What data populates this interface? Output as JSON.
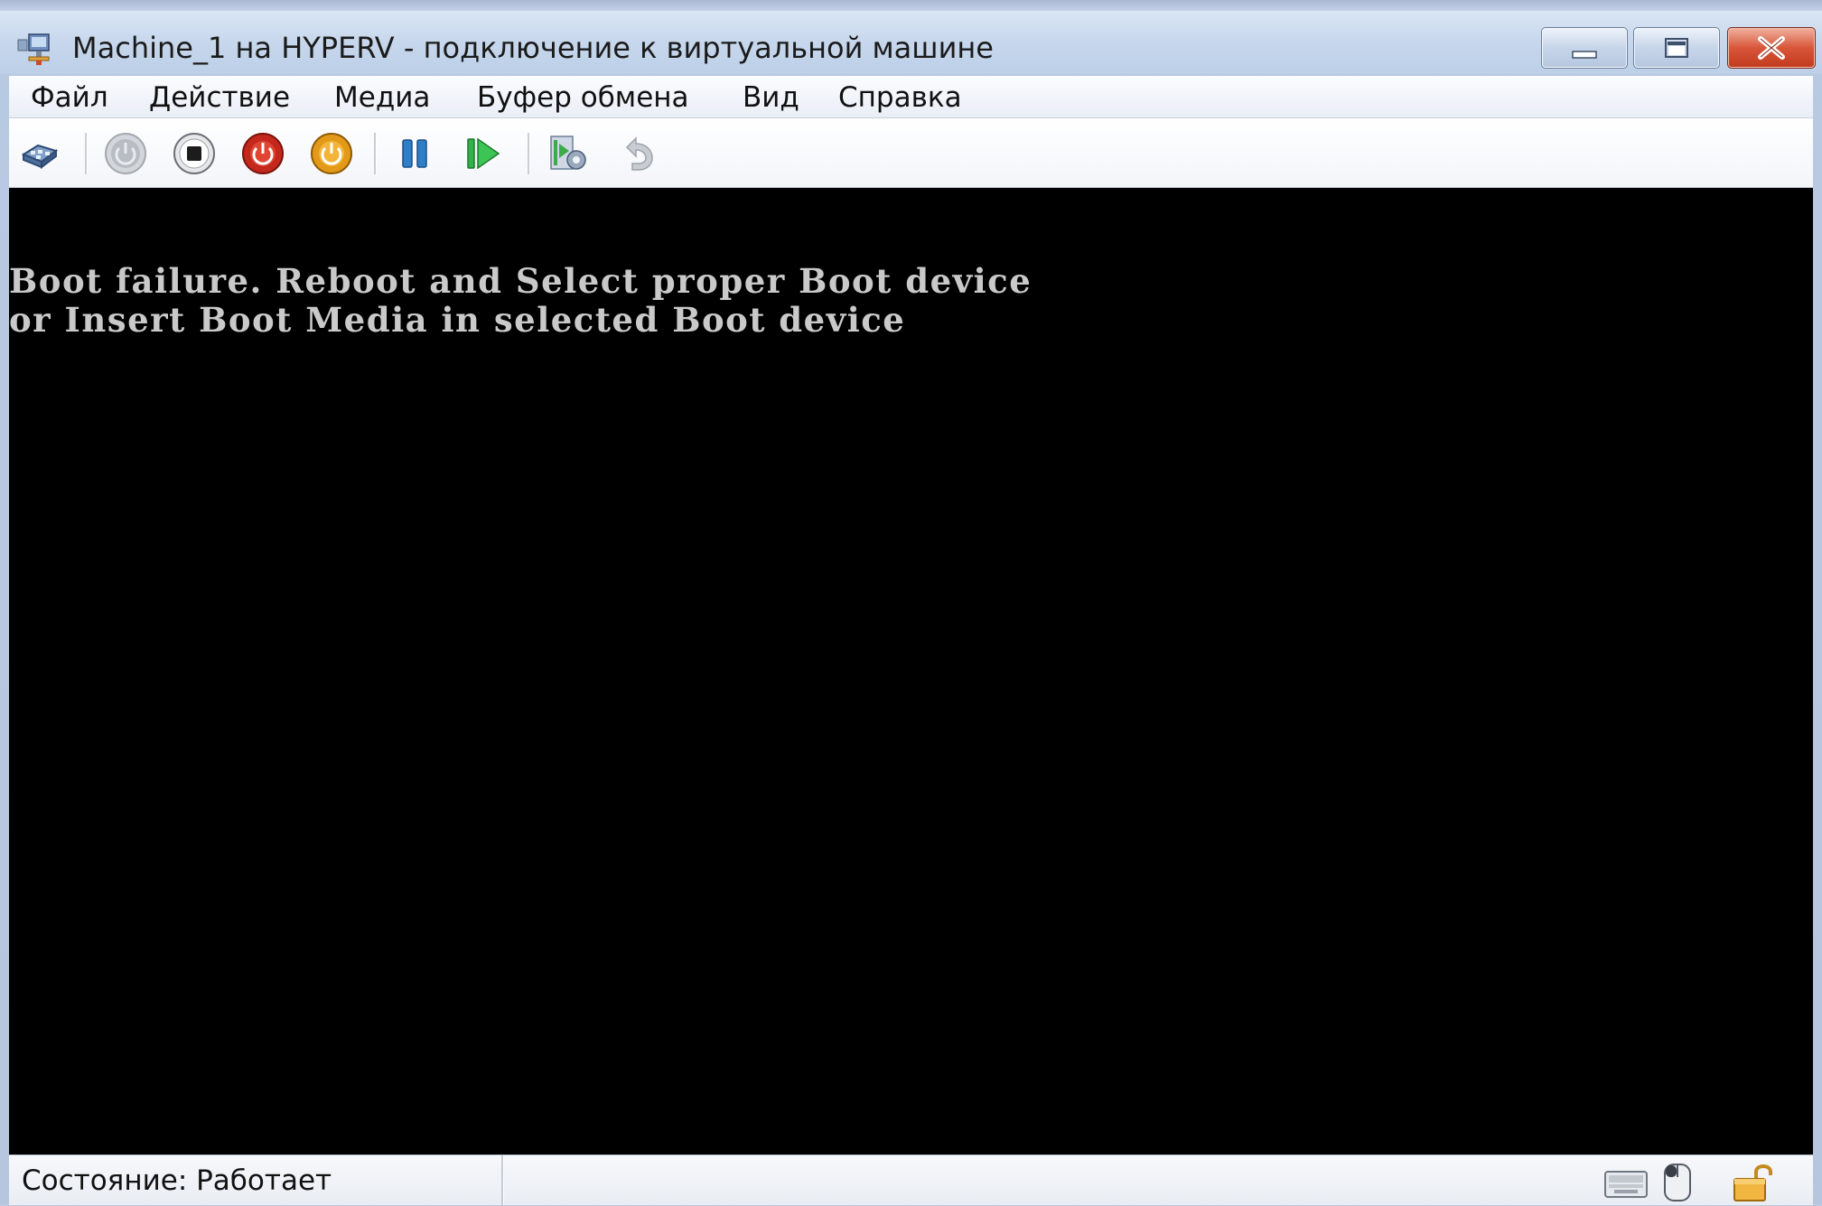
{
  "window": {
    "title": "Machine_1 на HYPERV - подключение к виртуальной машине",
    "controls": [
      "minimize-icon",
      "maximize-icon",
      "close-icon"
    ]
  },
  "menu": {
    "items": [
      "Файл",
      "Действие",
      "Медиа",
      "Буфер обмена",
      "Вид",
      "Справка"
    ]
  },
  "toolbar": {
    "buttons": [
      "ctrl-alt-del-icon",
      "start-icon",
      "turn-off-icon",
      "shut-down-icon",
      "save-icon",
      "pause-icon",
      "resume-icon",
      "snapshot-icon",
      "revert-icon"
    ]
  },
  "console": {
    "lines": [
      "Boot failure. Reboot and Select proper Boot device",
      "or Insert Boot Media in selected Boot device"
    ],
    "background": "#000000",
    "text_color": "#c9c9c9"
  },
  "status": {
    "text": "Состояние: Работает",
    "icons": [
      "keyboard-icon",
      "mouse-icon",
      "lock-icon"
    ]
  }
}
